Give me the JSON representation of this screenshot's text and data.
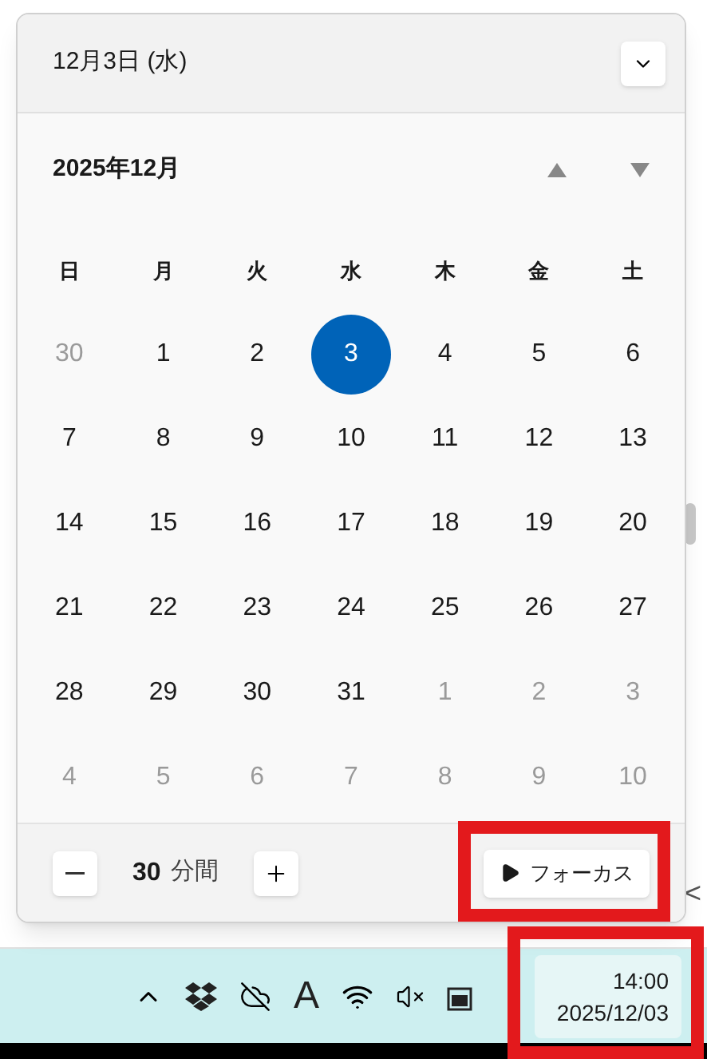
{
  "header": {
    "date": "12月3日 (水)"
  },
  "calendar": {
    "month": "2025年12月",
    "weekdays": [
      "日",
      "月",
      "火",
      "水",
      "木",
      "金",
      "土"
    ],
    "days": [
      {
        "label": "30",
        "in_month": false,
        "selected": false
      },
      {
        "label": "1",
        "in_month": true,
        "selected": false
      },
      {
        "label": "2",
        "in_month": true,
        "selected": false
      },
      {
        "label": "3",
        "in_month": true,
        "selected": true
      },
      {
        "label": "4",
        "in_month": true,
        "selected": false
      },
      {
        "label": "5",
        "in_month": true,
        "selected": false
      },
      {
        "label": "6",
        "in_month": true,
        "selected": false
      },
      {
        "label": "7",
        "in_month": true,
        "selected": false
      },
      {
        "label": "8",
        "in_month": true,
        "selected": false
      },
      {
        "label": "9",
        "in_month": true,
        "selected": false
      },
      {
        "label": "10",
        "in_month": true,
        "selected": false
      },
      {
        "label": "11",
        "in_month": true,
        "selected": false
      },
      {
        "label": "12",
        "in_month": true,
        "selected": false
      },
      {
        "label": "13",
        "in_month": true,
        "selected": false
      },
      {
        "label": "14",
        "in_month": true,
        "selected": false
      },
      {
        "label": "15",
        "in_month": true,
        "selected": false
      },
      {
        "label": "16",
        "in_month": true,
        "selected": false
      },
      {
        "label": "17",
        "in_month": true,
        "selected": false
      },
      {
        "label": "18",
        "in_month": true,
        "selected": false
      },
      {
        "label": "19",
        "in_month": true,
        "selected": false
      },
      {
        "label": "20",
        "in_month": true,
        "selected": false
      },
      {
        "label": "21",
        "in_month": true,
        "selected": false
      },
      {
        "label": "22",
        "in_month": true,
        "selected": false
      },
      {
        "label": "23",
        "in_month": true,
        "selected": false
      },
      {
        "label": "24",
        "in_month": true,
        "selected": false
      },
      {
        "label": "25",
        "in_month": true,
        "selected": false
      },
      {
        "label": "26",
        "in_month": true,
        "selected": false
      },
      {
        "label": "27",
        "in_month": true,
        "selected": false
      },
      {
        "label": "28",
        "in_month": true,
        "selected": false
      },
      {
        "label": "29",
        "in_month": true,
        "selected": false
      },
      {
        "label": "30",
        "in_month": true,
        "selected": false
      },
      {
        "label": "31",
        "in_month": true,
        "selected": false
      },
      {
        "label": "1",
        "in_month": false,
        "selected": false
      },
      {
        "label": "2",
        "in_month": false,
        "selected": false
      },
      {
        "label": "3",
        "in_month": false,
        "selected": false
      },
      {
        "label": "4",
        "in_month": false,
        "selected": false
      },
      {
        "label": "5",
        "in_month": false,
        "selected": false
      },
      {
        "label": "6",
        "in_month": false,
        "selected": false
      },
      {
        "label": "7",
        "in_month": false,
        "selected": false
      },
      {
        "label": "8",
        "in_month": false,
        "selected": false
      },
      {
        "label": "9",
        "in_month": false,
        "selected": false
      },
      {
        "label": "10",
        "in_month": false,
        "selected": false
      }
    ]
  },
  "focus": {
    "minutes": "30",
    "unit": "分間",
    "button": "フォーカス"
  },
  "side_arrow": "<",
  "taskbar": {
    "ime": "A",
    "time": "14:00",
    "date": "2025/12/03"
  }
}
